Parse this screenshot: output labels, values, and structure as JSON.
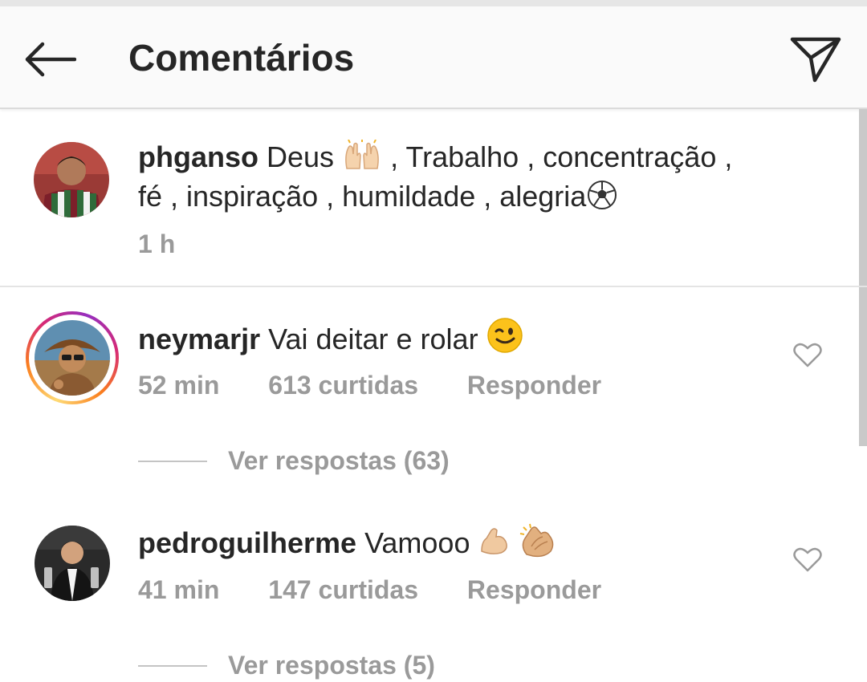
{
  "header": {
    "title": "Comentários",
    "back_icon": "arrow-left-icon",
    "share_icon": "paper-plane-icon"
  },
  "caption": {
    "username": "phganso",
    "text_line1_a": "Deus",
    "text_line1_b": ", Trabalho , concentração ,",
    "text_line2": "fé , inspiração , humildade , alegria",
    "time": "1 h"
  },
  "comments": [
    {
      "username": "neymarjr",
      "text": "Vai deitar e rolar",
      "time": "52 min",
      "likes": "613 curtidas",
      "reply_label": "Responder",
      "view_replies": "Ver respostas (63)"
    },
    {
      "username": "pedroguilherme",
      "text": "Vamooo",
      "time": "41 min",
      "likes": "147 curtidas",
      "reply_label": "Responder",
      "view_replies": "Ver respostas (5)"
    }
  ],
  "colors": {
    "text": "#262626",
    "meta": "#9a9a9a",
    "header_bg": "#fafafa",
    "divider": "#e4e4e4"
  }
}
